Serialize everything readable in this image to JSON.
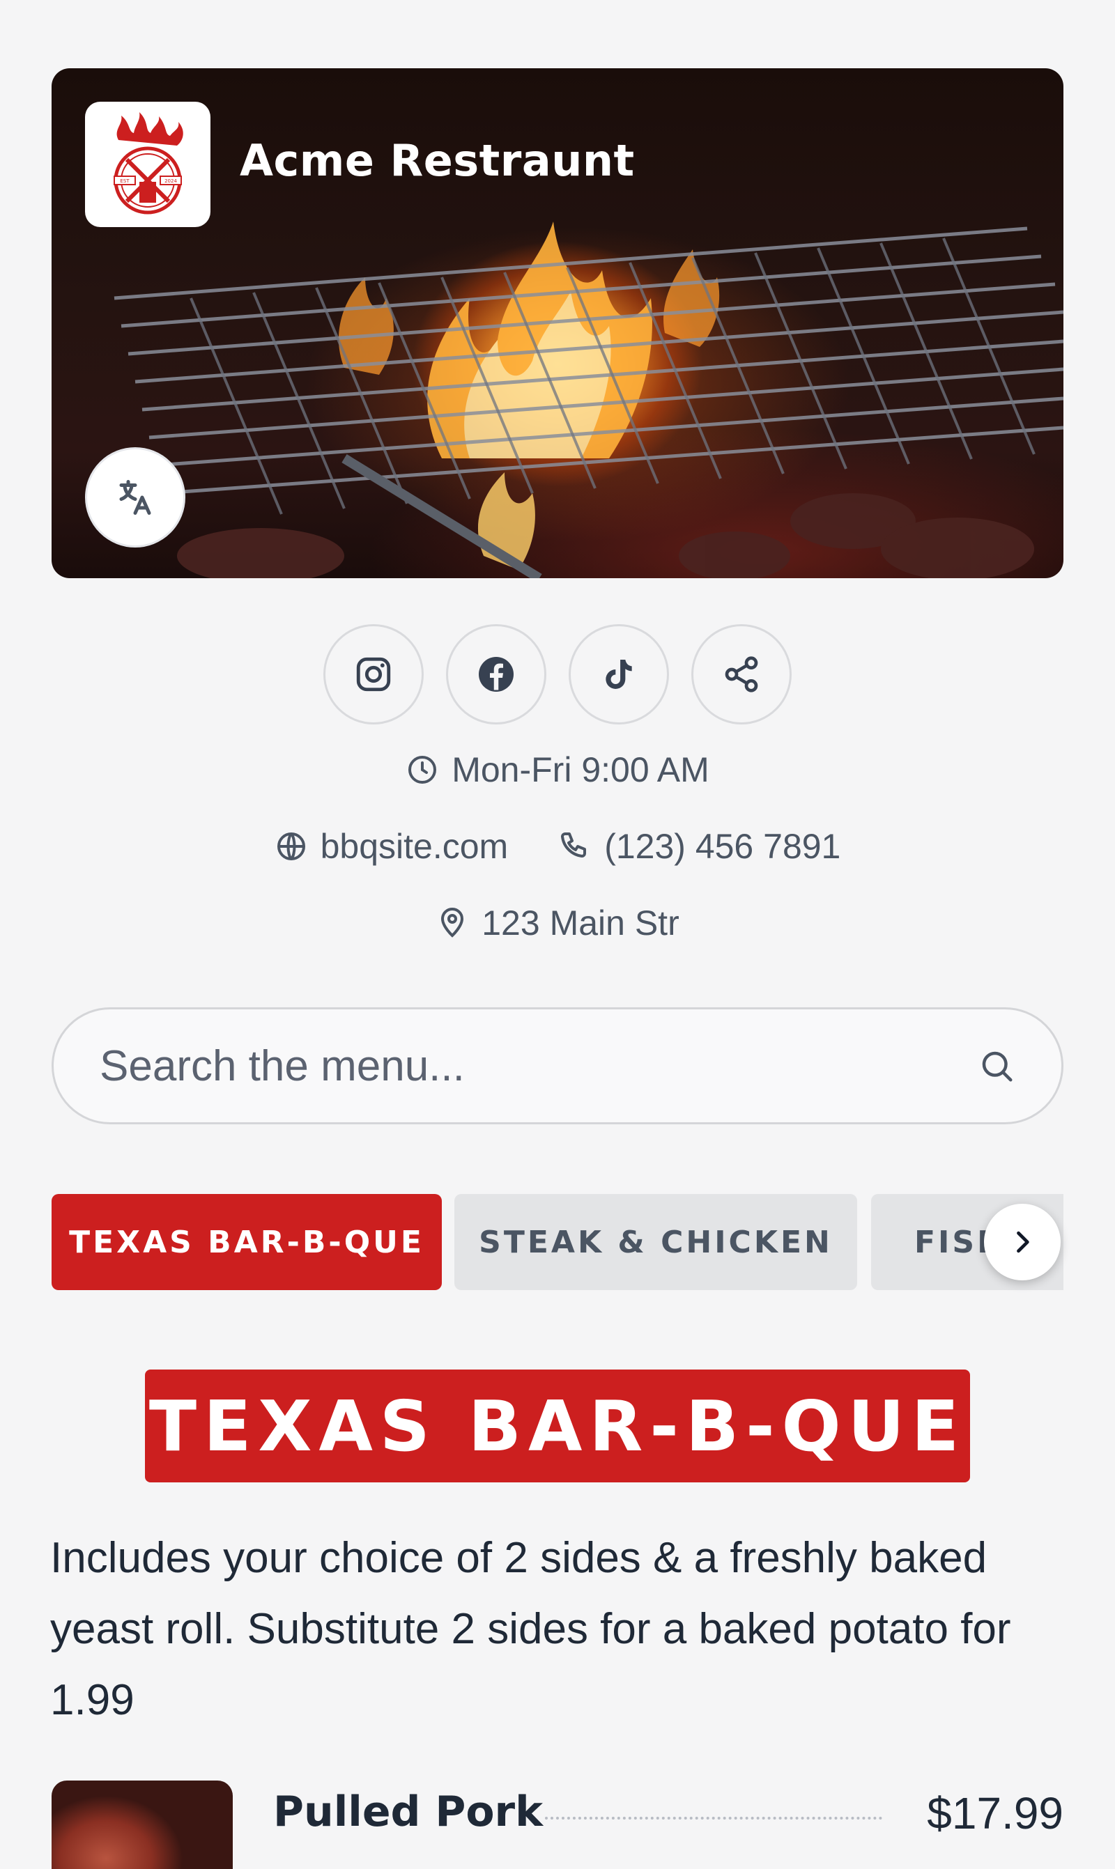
{
  "header": {
    "restaurant_name": "Acme Restraunt",
    "logo_text_left": "EST",
    "logo_text_right": "2024"
  },
  "social": {
    "instagram": "instagram-icon",
    "facebook": "facebook-icon",
    "tiktok": "tiktok-icon",
    "share": "share-icon"
  },
  "info": {
    "hours": "Mon-Fri 9:00 AM",
    "website": "bbqsite.com",
    "phone": "(123) 456 7891",
    "address": "123 Main Str"
  },
  "search": {
    "placeholder": "Search the menu...",
    "value": ""
  },
  "tabs": [
    {
      "label": "TEXAS BAR-B-QUE",
      "active": true
    },
    {
      "label": "STEAK & CHICKEN",
      "active": false
    },
    {
      "label": "FISH & SEAFOOD",
      "active": false
    }
  ],
  "section": {
    "title": "TEXAS BAR-B-QUE",
    "description": "Includes your choice of 2 sides & a freshly baked yeast roll. Substitute 2 sides for a baked potato for 1.99"
  },
  "items": [
    {
      "name": "Pulled Pork",
      "price": "$17.99"
    }
  ],
  "colors": {
    "accent": "#cc1f1f",
    "background": "#f5f5f6",
    "tab_inactive": "#e3e4e6"
  }
}
